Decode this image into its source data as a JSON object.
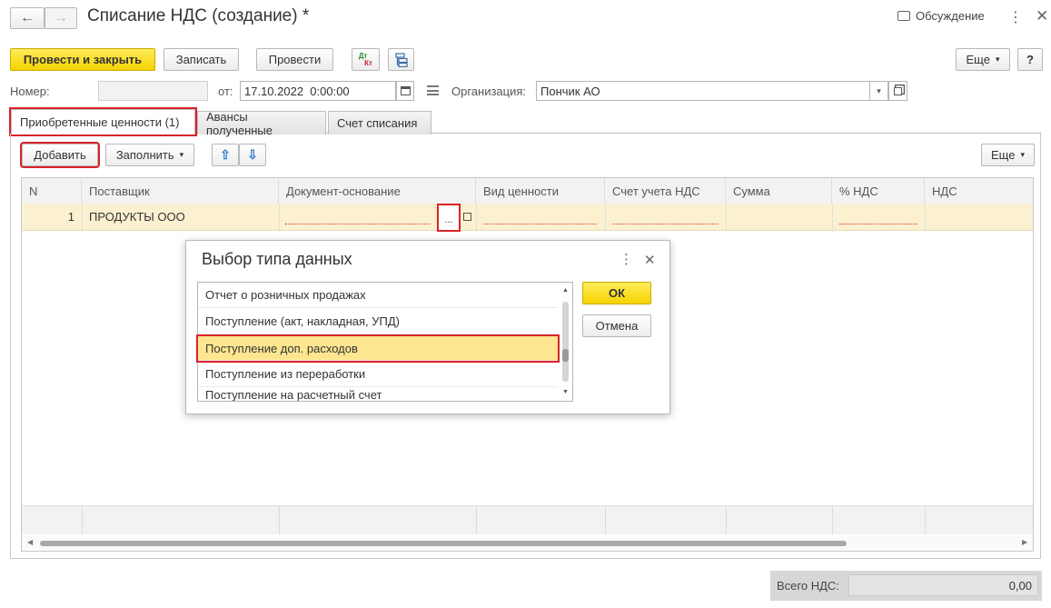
{
  "window": {
    "title": "Списание НДС (создание) *",
    "discussion_label": "Обсуждение"
  },
  "toolbar": {
    "post_close_label": "Провести и закрыть",
    "save_label": "Записать",
    "post_label": "Провести",
    "dtkt_dt": "Дт",
    "dtkt_kt": "Кт",
    "more_label": "Еще",
    "help_label": "?"
  },
  "header": {
    "number_label": "Номер:",
    "number_value": "",
    "date_label": "от:",
    "date_value": "17.10.2022  0:00:00",
    "org_label": "Организация:",
    "org_value": "Пончик АО"
  },
  "tabs": [
    {
      "label": "Приобретенные ценности (1)"
    },
    {
      "label": "Авансы полученные"
    },
    {
      "label": "Счет списания"
    }
  ],
  "table_toolbar": {
    "add_label": "Добавить",
    "fill_label": "Заполнить",
    "more_label": "Еще"
  },
  "table": {
    "columns": [
      "N",
      "Поставщик",
      "Документ-основание",
      "Вид ценности",
      "Счет учета НДС",
      "Сумма",
      "% НДС",
      "НДС"
    ],
    "rows": [
      {
        "n": "1",
        "supplier": "ПРОДУКТЫ ООО",
        "document": "",
        "kind": "",
        "account": "",
        "sum": "",
        "rate": "",
        "vat": ""
      }
    ],
    "select_button": "..."
  },
  "dialog": {
    "title": "Выбор типа данных",
    "items": [
      "Отчет о розничных продажах",
      "Поступление (акт, накладная, УПД)",
      "Поступление доп. расходов",
      "Поступление из переработки",
      "Поступление на расчетный счет"
    ],
    "selected_index": 2,
    "ok_label": "ОК",
    "cancel_label": "Отмена"
  },
  "footer": {
    "total_label": "Всего НДС:",
    "total_value": "0,00"
  },
  "colors": {
    "accent_yellow": "#f5d300",
    "highlight_row": "#fbf0cf",
    "selected_item": "#fde68f",
    "red_frame": "#d9232b"
  }
}
